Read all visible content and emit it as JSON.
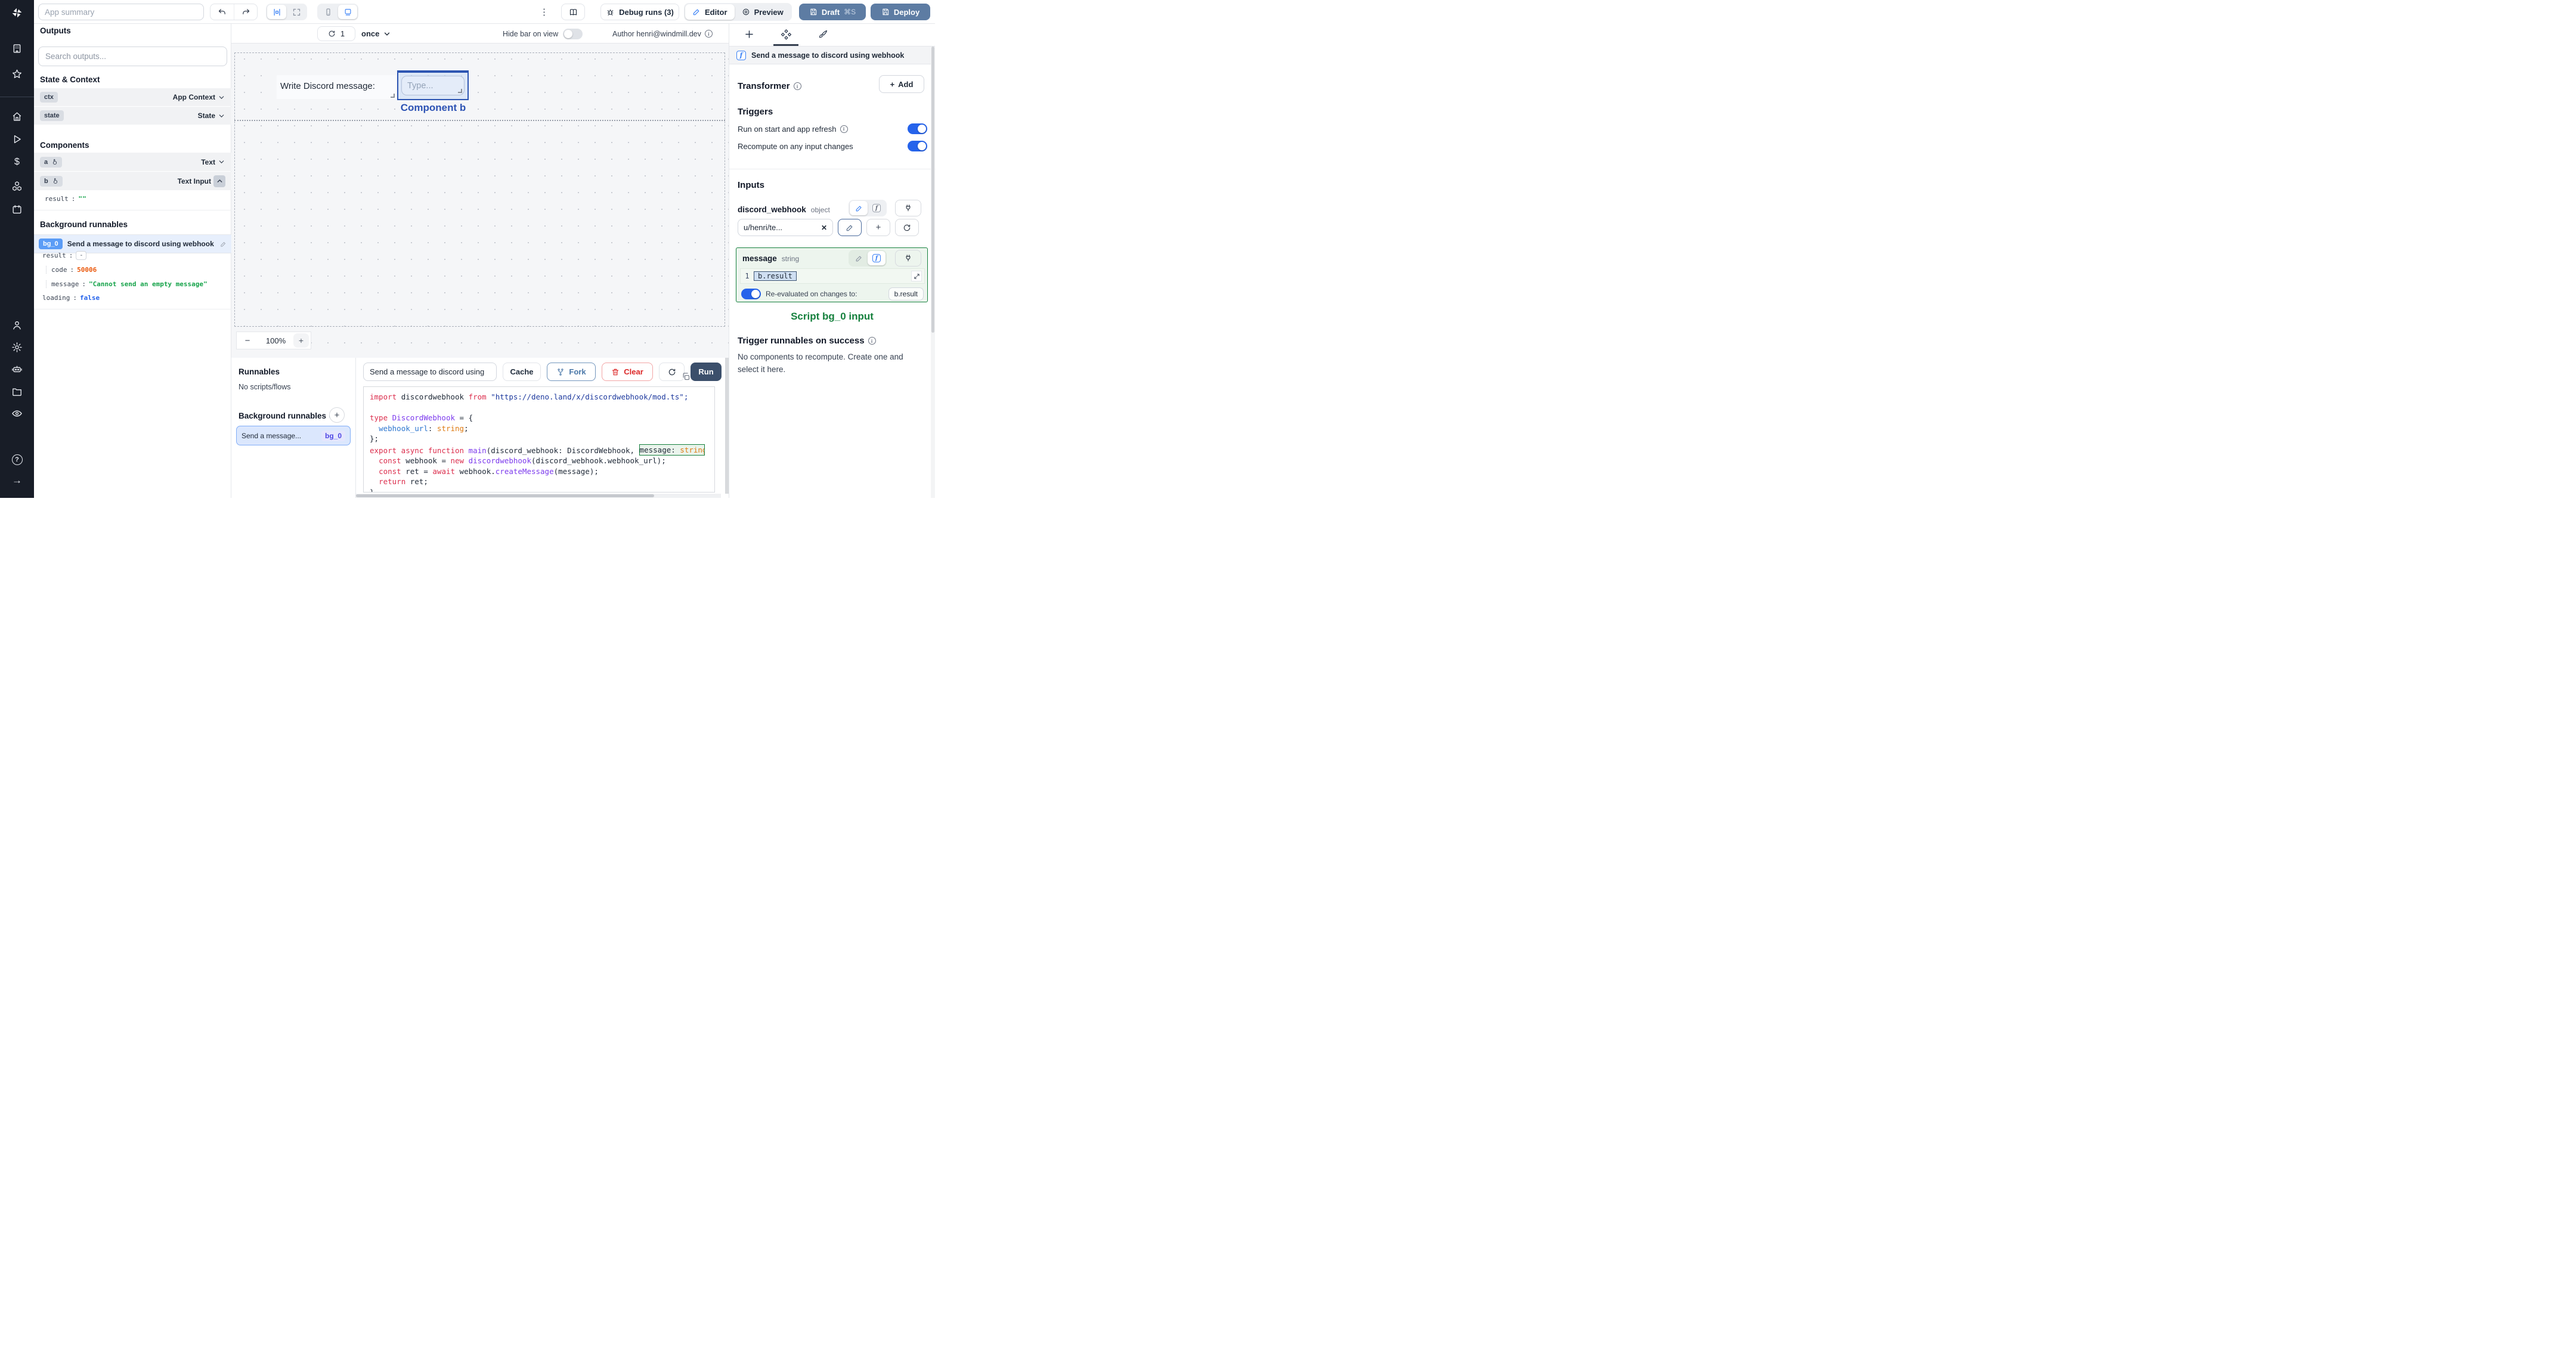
{
  "icons": {
    "colon": ":",
    "info": "i",
    "help": "?",
    "kebab": "⋮",
    "arrow_right": "→",
    "dollar": "$",
    "close": "✕",
    "plus": "+",
    "minus": "−",
    "collapse": "-"
  },
  "colors": {
    "accent": "#3b82f6",
    "selected_component": "#2d55b2",
    "draft_deploy_button": "#5d7ca3",
    "run_button": "#3b4f6b",
    "success_green": "#15803d",
    "error_orange": "#ea580c",
    "value_blue": "#2563eb",
    "bg_badge": "#5b9cf6"
  },
  "topbar": {
    "app_summary_placeholder": "App summary",
    "debug_runs_label": "Debug runs (3)",
    "editor_label": "Editor",
    "preview_label": "Preview",
    "draft_label": "Draft",
    "draft_shortcut": "⌘S",
    "deploy_label": "Deploy"
  },
  "outputs_panel": {
    "title": "Outputs",
    "search_placeholder": "Search outputs...",
    "state_context_title": "State & Context",
    "components_title": "Components",
    "background_title": "Background runnables",
    "ctx_key": "ctx",
    "ctx_type": "App Context",
    "state_key": "state",
    "state_type": "State",
    "a_key": "a",
    "a_type": "Text",
    "b_key": "b",
    "b_type": "Text Input",
    "b_result_key": "result",
    "b_result_value": "\"\"",
    "bg0_badge": "bg_0",
    "bg0_label": "Send a message to discord using webhook",
    "bg0_result_key": "result",
    "bg0_code_key": "code",
    "bg0_code_value": "50006",
    "bg0_message_key": "message",
    "bg0_message_value": "\"Cannot send an empty message\"",
    "bg0_loading_key": "loading",
    "bg0_loading_value": "false"
  },
  "canvas": {
    "refresh_count": "1",
    "mode": "once",
    "hide_bar_label": "Hide bar on view",
    "author_label": "Author henri@windmill.dev",
    "text_component": "Write Discord message:",
    "input_placeholder": "Type...",
    "selected_component_label": "Component b",
    "zoom_level": "100%"
  },
  "runnables_panel": {
    "title": "Runnables",
    "empty": "No scripts/flows",
    "background_title": "Background runnables",
    "item_label": "Send a message...",
    "item_badge": "bg_0"
  },
  "code_panel": {
    "script_name": "Send a message to discord using",
    "cache_label": "Cache",
    "fork_label": "Fork",
    "clear_label": "Clear",
    "run_label": "Run",
    "code": {
      "l1_kw1": "import ",
      "l1_id": "discordwebhook ",
      "l1_kw2": "from ",
      "l1_str": "\"https://deno.land/x/discordwebhook/mod.ts\";",
      "l3_kw": "type ",
      "l3_type": "DiscordWebhook ",
      "l3_op": "= {",
      "l4_ind": "  ",
      "l4_prop": "webhook_url",
      "l4_op": ": ",
      "l4_bi": "string",
      "l4_semi": ";",
      "l5": "};",
      "l6_kw": "export async function ",
      "l6_fn": "main",
      "l6_rest": "(discord_webhook: DiscordWebhook, ",
      "l6_param": "message: ",
      "l6_type": "string",
      "l7_ind": "  ",
      "l7_kw": "const ",
      "l7_id": "webhook ",
      "l7_eq": "= ",
      "l7_new": "new ",
      "l7_fn": "discordwebhook",
      "l7_rest": "(discord_webhook.webhook_url);",
      "l8_ind": "  ",
      "l8_kw": "const ",
      "l8_id": "ret ",
      "l8_eq": "= ",
      "l8_await": "await ",
      "l8_obj": "webhook.",
      "l8_fn": "createMessage",
      "l8_rest": "(message);",
      "l9_ind": "  ",
      "l9_kw": "return ",
      "l9_id": "ret;",
      "l10": "}"
    }
  },
  "right_panel": {
    "header": "Send a message to discord using webhook",
    "fn_glyph": "f",
    "transformer_label": "Transformer",
    "add_label": "Add",
    "triggers_title": "Triggers",
    "run_on_start_label": "Run on start and app refresh",
    "recompute_label": "Recompute on any input changes",
    "inputs_title": "Inputs",
    "discord_webhook_name": "discord_webhook",
    "discord_webhook_type": "object",
    "discord_webhook_value": "u/henri/te...",
    "message_name": "message",
    "message_type": "string",
    "message_line": "1",
    "message_value": "b.result",
    "reeval_label": "Re-evaluated on changes to:",
    "reeval_value": "b.result",
    "script_input_label": "Script bg_0 input",
    "trigger_success_label": "Trigger runnables on success",
    "empty_text": "No components to recompute. Create one and select it here."
  }
}
